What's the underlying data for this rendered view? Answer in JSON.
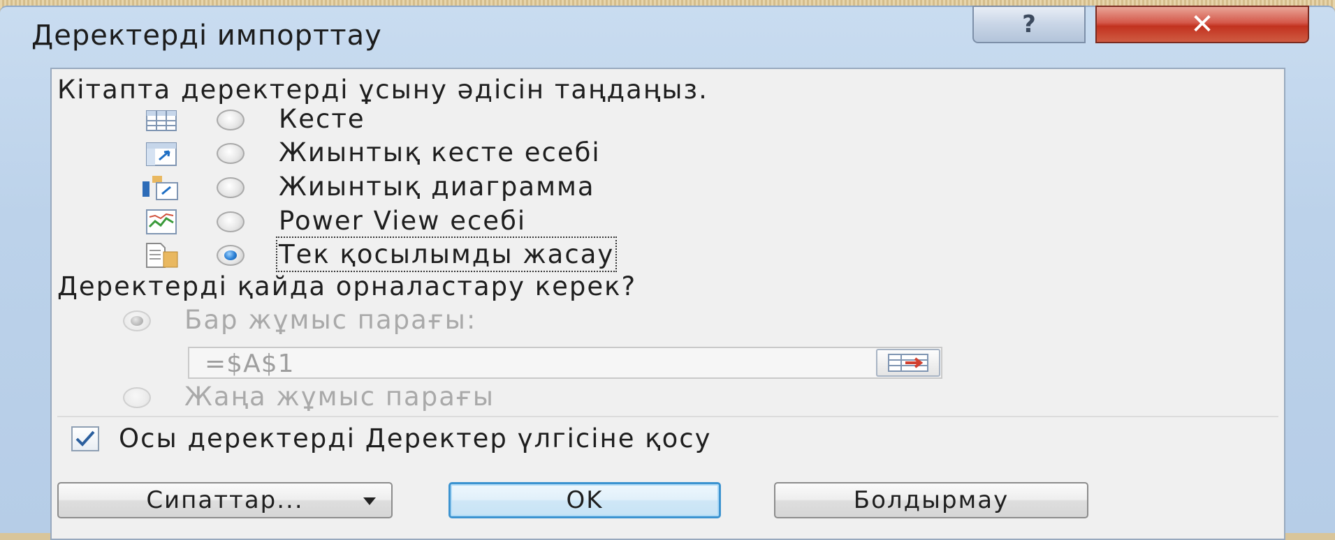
{
  "window": {
    "title": "Деректерді импорттау",
    "help_label": "?",
    "close_label": "✕"
  },
  "view_section": {
    "heading": "Кітапта деректерді ұсыну әдісін таңдаңыз.",
    "options": [
      {
        "label": "Кесте",
        "icon": "table-icon",
        "checked": false
      },
      {
        "label": "Жиынтық кесте есебі",
        "icon": "pivot-table-icon",
        "checked": false
      },
      {
        "label": "Жиынтық диаграмма",
        "icon": "pivot-chart-icon",
        "checked": false
      },
      {
        "label": "Power View есебі",
        "icon": "power-view-icon",
        "checked": false
      },
      {
        "label": "Тек қосылымды жасау",
        "icon": "connection-only-icon",
        "checked": true
      }
    ]
  },
  "location_section": {
    "heading": "Деректерді қайда орналастару керек?",
    "existing_sheet_label": "Бар жұмыс парағы:",
    "existing_sheet_checked": true,
    "reference_value": "=$A$1",
    "new_sheet_label": "Жаңа жұмыс парағы",
    "new_sheet_checked": false,
    "enabled": false
  },
  "data_model": {
    "label": "Осы деректерді Деректер үлгісіне қосу",
    "checked": true,
    "check_mark": "✓"
  },
  "buttons": {
    "properties_label": "Сипаттар...",
    "ok_label": "OK",
    "cancel_label": "Болдырмау"
  },
  "colors": {
    "title_bar": "#bcd2ea",
    "close_button": "#c2321f",
    "content_bg": "#f0f0f0",
    "radio_selected": "#2a7fd4",
    "default_button_border": "#3c93d0"
  }
}
